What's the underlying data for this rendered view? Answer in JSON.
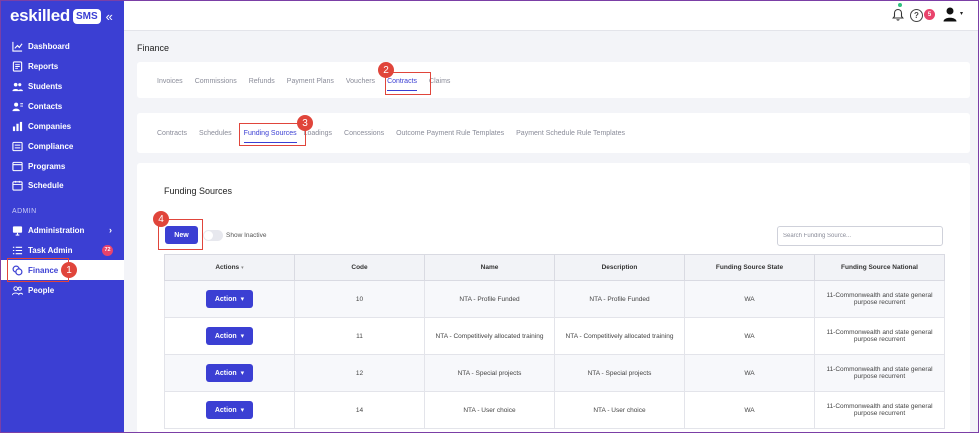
{
  "brand": {
    "name": "eskilled",
    "badge": "SMS",
    "collapse_glyph": "«"
  },
  "sidebar": {
    "items": [
      {
        "label": "Dashboard",
        "icon": "chart-line-icon"
      },
      {
        "label": "Reports",
        "icon": "report-icon"
      },
      {
        "label": "Students",
        "icon": "users-icon"
      },
      {
        "label": "Contacts",
        "icon": "contact-icon"
      },
      {
        "label": "Companies",
        "icon": "bar-chart-icon"
      },
      {
        "label": "Compliance",
        "icon": "checklist-icon"
      },
      {
        "label": "Programs",
        "icon": "window-icon"
      },
      {
        "label": "Schedule",
        "icon": "calendar-icon"
      }
    ],
    "section_label": "ADMIN",
    "admin_items": [
      {
        "label": "Administration",
        "icon": "monitor-icon",
        "chevron": "›"
      },
      {
        "label": "Task Admin",
        "icon": "list-icon",
        "badge": "72"
      },
      {
        "label": "Finance",
        "icon": "coins-icon",
        "active": true
      },
      {
        "label": "People",
        "icon": "people-icon"
      }
    ]
  },
  "topbar": {
    "notification_count": "5",
    "help_glyph": "?",
    "user_caret": "▾"
  },
  "page": {
    "title": "Finance"
  },
  "finance_tabs": [
    "Invoices",
    "Commissions",
    "Refunds",
    "Payment Plans",
    "Vouchers",
    "Contracts",
    "Claims"
  ],
  "contract_tabs": [
    "Contracts",
    "Schedules",
    "Funding Sources",
    "Loadings",
    "Concessions",
    "Outcome Payment Rule Templates",
    "Payment Schedule Rule Templates"
  ],
  "callouts": [
    "1",
    "2",
    "3",
    "4"
  ],
  "funding": {
    "title": "Funding Sources",
    "new_label": "New",
    "show_inactive_label": "Show Inactive",
    "search_placeholder": "Search Funding Source...",
    "columns": [
      "Actions",
      "Code",
      "Name",
      "Description",
      "Funding Source State",
      "Funding Source National"
    ],
    "action_label": "Action",
    "rows": [
      {
        "code": "10",
        "name": "NTA - Profile Funded",
        "description": "NTA - Profile Funded",
        "state": "WA",
        "national": "11-Commonwealth and state general purpose recurrent"
      },
      {
        "code": "11",
        "name": "NTA - Competitively allocated training",
        "description": "NTA - Competitively allocated training",
        "state": "WA",
        "national": "11-Commonwealth and state general purpose recurrent"
      },
      {
        "code": "12",
        "name": "NTA - Special projects",
        "description": "NTA - Special projects",
        "state": "WA",
        "national": "11-Commonwealth and state general purpose recurrent"
      },
      {
        "code": "14",
        "name": "NTA - User choice",
        "description": "NTA - User choice",
        "state": "WA",
        "national": "11-Commonwealth and state general purpose recurrent"
      }
    ]
  },
  "colors": {
    "primary": "#3b3fd3",
    "callout": "#e0453b",
    "badge": "#e9436b"
  }
}
